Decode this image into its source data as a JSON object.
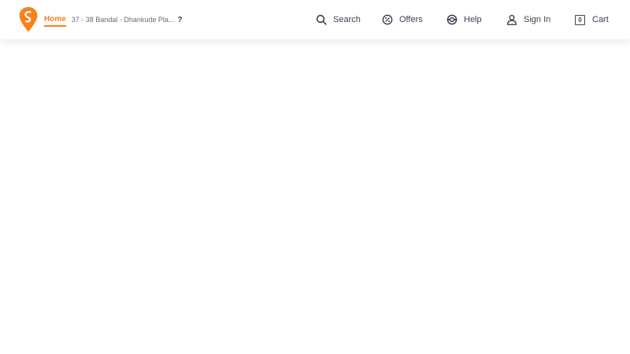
{
  "header": {
    "logo_icon": "swiggy-logo-icon",
    "location": {
      "label": "Home",
      "address": "37 - 38 Bandal - Dhankude Pla...",
      "caret": "?"
    },
    "nav": {
      "search": {
        "label": "Search",
        "icon": "search-icon"
      },
      "offers": {
        "label": "Offers",
        "icon": "offer-badge-icon"
      },
      "help": {
        "label": "Help",
        "icon": "lifebuoy-icon"
      },
      "signin": {
        "label": "Sign In",
        "icon": "user-icon"
      },
      "cart": {
        "label": "Cart",
        "count": "0",
        "icon": "cart-bag-icon"
      }
    }
  },
  "colors": {
    "brand": "#fc8019",
    "text": "#3d4152",
    "muted": "#686b78",
    "background": "#ffffff"
  }
}
